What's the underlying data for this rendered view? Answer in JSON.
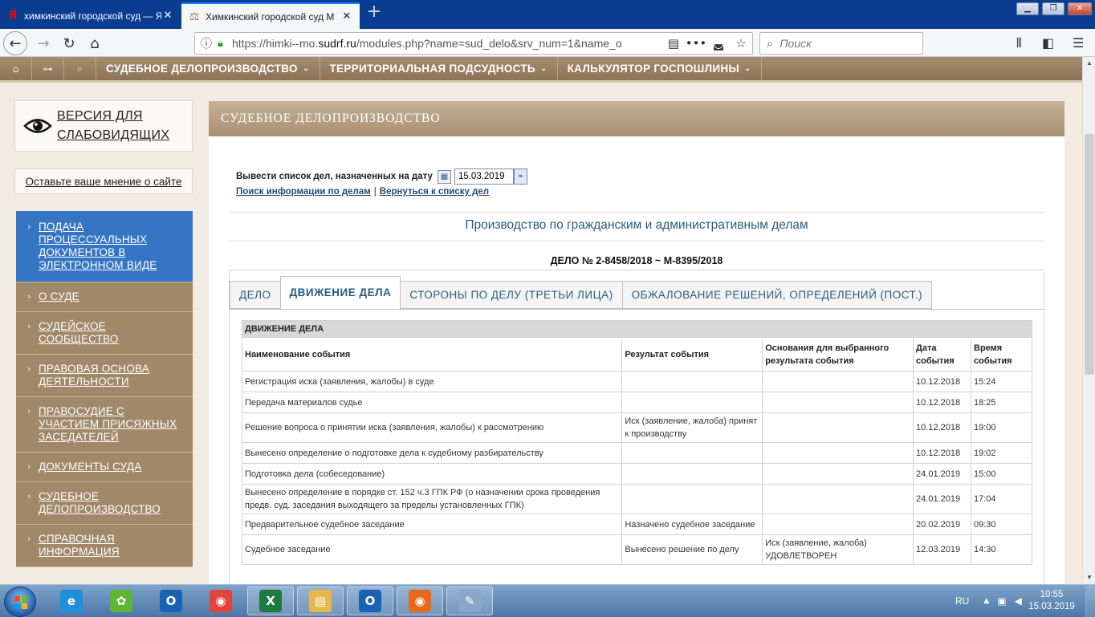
{
  "browser": {
    "tabs": [
      {
        "title": "химкинский городской суд — Я",
        "favicon": "yandex-icon",
        "active": false
      },
      {
        "title": "Химкинский городской суд М",
        "favicon": "court-scales-icon",
        "active": true
      }
    ],
    "url_prefix": "https://himki--mo.",
    "url_domain": "sudrf.ru",
    "url_path": "/modules.php?name=sud_delo&srv_num=1&name_o",
    "search_placeholder": "Поиск"
  },
  "site_nav": {
    "items": [
      {
        "label": "СУДЕБНОЕ ДЕЛОПРОИЗВОДСТВО"
      },
      {
        "label": "ТЕРРИТОРИАЛЬНАЯ ПОДСУДНОСТЬ"
      },
      {
        "label": "КАЛЬКУЛЯТОР ГОСПОШЛИНЫ"
      }
    ]
  },
  "sidebar": {
    "accessibility_label": "ВЕРСИЯ ДЛЯ СЛАБОВИДЯЩИХ",
    "feedback_label": "Оставьте ваше мнение о сайте",
    "menu": [
      {
        "label": "ПОДАЧА ПРОЦЕССУАЛЬНЫХ ДОКУМЕНТОВ В ЭЛЕКТРОННОМ ВИДЕ",
        "active": true
      },
      {
        "label": "О СУДЕ",
        "active": false
      },
      {
        "label": "СУДЕЙСКОЕ СООБЩЕСТВО",
        "active": false
      },
      {
        "label": "ПРАВОВАЯ ОСНОВА ДЕЯТЕЛЬНОСТИ",
        "active": false
      },
      {
        "label": "ПРАВОСУДИЕ С УЧАСТИЕМ ПРИСЯЖНЫХ ЗАСЕДАТЕЛЕЙ",
        "active": false
      },
      {
        "label": "ДОКУМЕНТЫ СУДА",
        "active": false
      },
      {
        "label": "СУДЕБНОЕ ДЕЛОПРОИЗВОДСТВО",
        "active": false
      },
      {
        "label": "СПРАВОЧНАЯ ИНФОРМАЦИЯ",
        "active": false
      }
    ]
  },
  "main": {
    "header": "СУДЕБНОЕ ДЕЛОПРОИЗВОДСТВО",
    "date_label": "Вывести список дел, назначенных на дату",
    "date_value": "15.03.2019",
    "link_search": "Поиск информации по делам",
    "link_sep": "|",
    "link_back": "Вернуться к списку дел",
    "section_title": "Производство по гражданским и административным делам",
    "case_title": "ДЕЛО № 2-8458/2018 ~ М-8395/2018",
    "tabs": [
      {
        "label": "ДЕЛО",
        "active": false
      },
      {
        "label": "ДВИЖЕНИЕ ДЕЛА",
        "active": true
      },
      {
        "label": "СТОРОНЫ ПО ДЕЛУ (ТРЕТЬИ ЛИЦА)",
        "active": false
      },
      {
        "label": "ОБЖАЛОВАНИЕ РЕШЕНИЙ, ОПРЕДЕЛЕНИЙ (ПОСТ.)",
        "active": false
      }
    ],
    "table": {
      "caption": "ДВИЖЕНИЕ ДЕЛА",
      "columns": [
        "Наименование события",
        "Результат события",
        "Основания для выбранного результата события",
        "Дата события",
        "Время события"
      ],
      "rows": [
        [
          "Регистрация иска (заявления, жалобы) в суде",
          "",
          "",
          "10.12.2018",
          "15:24"
        ],
        [
          "Передача материалов судье",
          "",
          "",
          "10.12.2018",
          "18:25"
        ],
        [
          "Решение вопроса о принятии иска (заявления, жалобы) к рассмотрению",
          "Иск (заявление, жалоба) принят к производству",
          "",
          "10.12.2018",
          "19:00"
        ],
        [
          "Вынесено определение о подготовке дела к судебному разбирательству",
          "",
          "",
          "10.12.2018",
          "19:02"
        ],
        [
          "Подготовка дела (собеседование)",
          "",
          "",
          "24.01.2019",
          "15:00"
        ],
        [
          "Вынесено определение в порядке ст. 152 ч.3 ГПК РФ (о назначении срока проведения предв. суд. заседания выходящего за пределы установленных ГПК)",
          "",
          "",
          "24.01.2019",
          "17:04"
        ],
        [
          "Предварительное судебное заседание",
          "Назначено судебное заседание",
          "",
          "20.02.2019",
          "09:30"
        ],
        [
          "Судебное заседание",
          "Вынесено решение по делу",
          "Иск (заявление, жалоба) УДОВЛЕТВОРЕН",
          "12.03.2019",
          "14:30"
        ]
      ]
    }
  },
  "taskbar": {
    "apps": [
      {
        "name": "internet-explorer-icon",
        "color": "#1e8fd8"
      },
      {
        "name": "icq-icon",
        "color": "#5cb832"
      },
      {
        "name": "outlook-icon",
        "color": "#1a62b4"
      },
      {
        "name": "chrome-icon",
        "color": "#e0443a"
      },
      {
        "name": "excel-icon",
        "color": "#1f7a3f"
      },
      {
        "name": "file-explorer-icon",
        "color": "#e6b84a"
      },
      {
        "name": "outlook-icon-2",
        "color": "#1a62b4"
      },
      {
        "name": "firefox-icon",
        "color": "#e66a1a"
      },
      {
        "name": "paint-icon",
        "color": "#8aa7c9"
      }
    ],
    "language": "RU",
    "time": "10:55",
    "date": "15.03.2019"
  }
}
